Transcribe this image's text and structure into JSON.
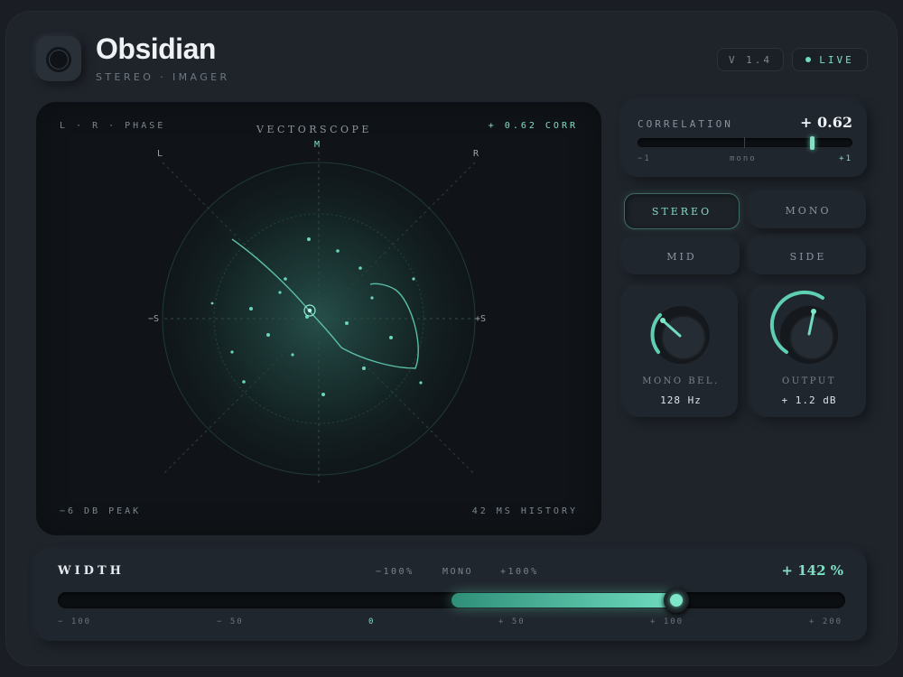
{
  "app": {
    "title": "Obsidian",
    "subtitle": "STEREO · IMAGER"
  },
  "header": {
    "version": "V 1.4",
    "live": "LIVE"
  },
  "scope": {
    "title": "VECTORSCOPE",
    "mode_label": "L · R · PHASE",
    "corr_readout": "+ 0.62 CORR",
    "axis_m": "M",
    "axis_l": "L",
    "axis_r": "R",
    "axis_neg_s": "−S",
    "axis_pos_s": "+S",
    "peak": "−6 DB PEAK",
    "history": "42 MS HISTORY"
  },
  "correlation": {
    "label": "CORRELATION",
    "value": "+ 0.62",
    "level": 0.62,
    "min": "−1",
    "mid": "mono",
    "max": "+1"
  },
  "modes": [
    {
      "label": "STEREO",
      "active": true
    },
    {
      "label": "MONO",
      "active": false
    },
    {
      "label": "MID",
      "active": false
    },
    {
      "label": "SIDE",
      "active": false
    }
  ],
  "knobs": {
    "mono_below": {
      "label": "MONO BEL.",
      "value": "128 Hz"
    },
    "output": {
      "label": "OUTPUT",
      "value": "+ 1.2 dB"
    }
  },
  "width": {
    "title": "WIDTH",
    "value": "+ 142 %",
    "value_numeric": 142,
    "presets": [
      "−100%",
      "MONO",
      "+100%"
    ],
    "scale": [
      "− 100",
      "− 50",
      "0",
      "+ 50",
      "+ 100",
      "+ 200"
    ]
  },
  "colors": {
    "accent": "#7fe0c3",
    "background": "#1f242b",
    "scope_bg": "#101418"
  }
}
